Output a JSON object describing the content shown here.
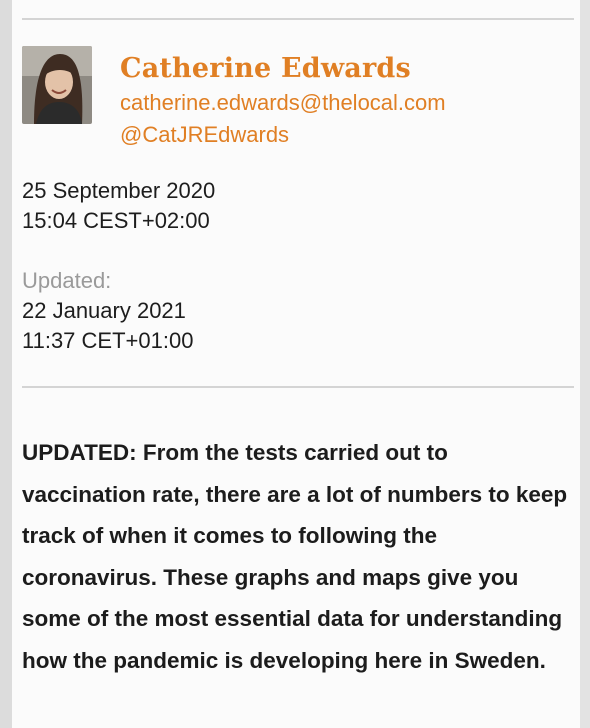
{
  "author": {
    "name": "Catherine Edwards",
    "email": "catherine.edwards@thelocal.com",
    "twitter": "@CatJREdwards"
  },
  "published": {
    "date": "25 September 2020",
    "time": "15:04 CEST+02:00"
  },
  "updated": {
    "label": "Updated:",
    "date": "22 January 2021",
    "time": "11:37 CET+01:00"
  },
  "article": {
    "lead": "UPDATED: From the tests carried out to vaccination rate, there are a lot of numbers to keep track of when it comes to following the coronavirus. These graphs and maps give you some of the most essential data for understanding how the pandemic is developing here in Sweden."
  },
  "colors": {
    "accent": "#e07f24",
    "text": "#1d1d1d",
    "muted": "#9a9a9a",
    "divider": "#d4d4d4"
  }
}
